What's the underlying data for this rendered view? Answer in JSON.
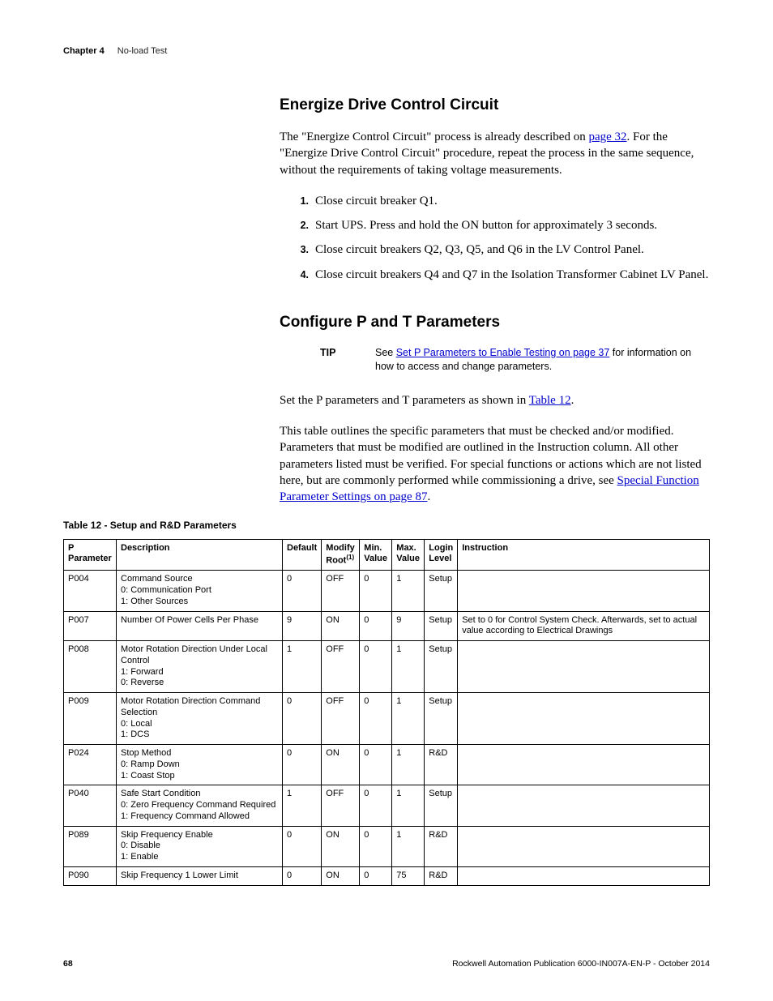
{
  "header": {
    "chapter": "Chapter 4",
    "title": "No-load Test"
  },
  "section1": {
    "heading": "Energize Drive Control Circuit",
    "intro_1": "The \"Energize Control Circuit\" process is already described on ",
    "intro_link": "page 32",
    "intro_2": ". For the \"Energize Drive Control Circuit\" procedure, repeat the process in the same sequence, without the requirements of taking voltage measurements.",
    "steps": [
      "Close circuit breaker Q1.",
      "Start UPS. Press and hold the ON button for approximately 3 seconds.",
      "Close circuit breakers Q2, Q3, Q5, and Q6 in the LV Control Panel.",
      "Close circuit breakers Q4 and Q7 in the Isolation Transformer Cabinet LV Panel."
    ]
  },
  "section2": {
    "heading": "Configure P and T Parameters",
    "tip_label": "TIP",
    "tip_1": "See ",
    "tip_link": "Set P Parameters to Enable Testing on page 37",
    "tip_2": " for information on how to access and change parameters.",
    "para1_1": "Set the P parameters and T parameters as shown in ",
    "para1_link": "Table 12",
    "para1_2": ".",
    "para2_1": "This table outlines the specific parameters that must be checked and/or modified. Parameters that must be modified are outlined in the Instruction column. All other parameters listed must be verified. For special functions or actions which are not listed here, but are commonly performed while commissioning a drive, see ",
    "para2_link": "Special Function Parameter Settings on page 87",
    "para2_2": "."
  },
  "table": {
    "caption": "Table 12 - Setup and R&D Parameters",
    "headers": {
      "p": "P Parameter",
      "desc": "Description",
      "def": "Default",
      "mod": "Modify Root",
      "mod_sup": "(1)",
      "min": "Min. Value",
      "max": "Max. Value",
      "login": "Login Level",
      "instr": "Instruction"
    },
    "rows": [
      {
        "p": "P004",
        "desc": "Command Source\n0: Communication Port\n1: Other Sources",
        "def": "0",
        "mod": "OFF",
        "min": "0",
        "max": "1",
        "login": "Setup",
        "instr": ""
      },
      {
        "p": "P007",
        "desc": "Number Of Power Cells Per Phase",
        "def": "9",
        "mod": "ON",
        "min": "0",
        "max": "9",
        "login": "Setup",
        "instr": "Set to 0 for Control System Check. Afterwards, set to actual value according to Electrical Drawings"
      },
      {
        "p": "P008",
        "desc": "Motor Rotation Direction Under Local Control\n1: Forward\n0: Reverse",
        "def": "1",
        "mod": "OFF",
        "min": "0",
        "max": "1",
        "login": "Setup",
        "instr": ""
      },
      {
        "p": "P009",
        "desc": "Motor Rotation Direction Command Selection\n0: Local\n1: DCS",
        "def": "0",
        "mod": "OFF",
        "min": "0",
        "max": "1",
        "login": "Setup",
        "instr": ""
      },
      {
        "p": "P024",
        "desc": "Stop Method\n0: Ramp Down\n1: Coast Stop",
        "def": "0",
        "mod": "ON",
        "min": "0",
        "max": "1",
        "login": "R&D",
        "instr": ""
      },
      {
        "p": "P040",
        "desc": "Safe Start Condition\n0: Zero Frequency Command Required\n1: Frequency Command Allowed",
        "def": "1",
        "mod": "OFF",
        "min": "0",
        "max": "1",
        "login": "Setup",
        "instr": ""
      },
      {
        "p": "P089",
        "desc": "Skip Frequency Enable\n0: Disable\n1: Enable",
        "def": "0",
        "mod": "ON",
        "min": "0",
        "max": "1",
        "login": "R&D",
        "instr": ""
      },
      {
        "p": "P090",
        "desc": "Skip Frequency 1 Lower Limit",
        "def": "0",
        "mod": "ON",
        "min": "0",
        "max": "75",
        "login": "R&D",
        "instr": ""
      }
    ]
  },
  "footer": {
    "page": "68",
    "pub": "Rockwell Automation Publication 6000-IN007A-EN-P - October 2014"
  }
}
